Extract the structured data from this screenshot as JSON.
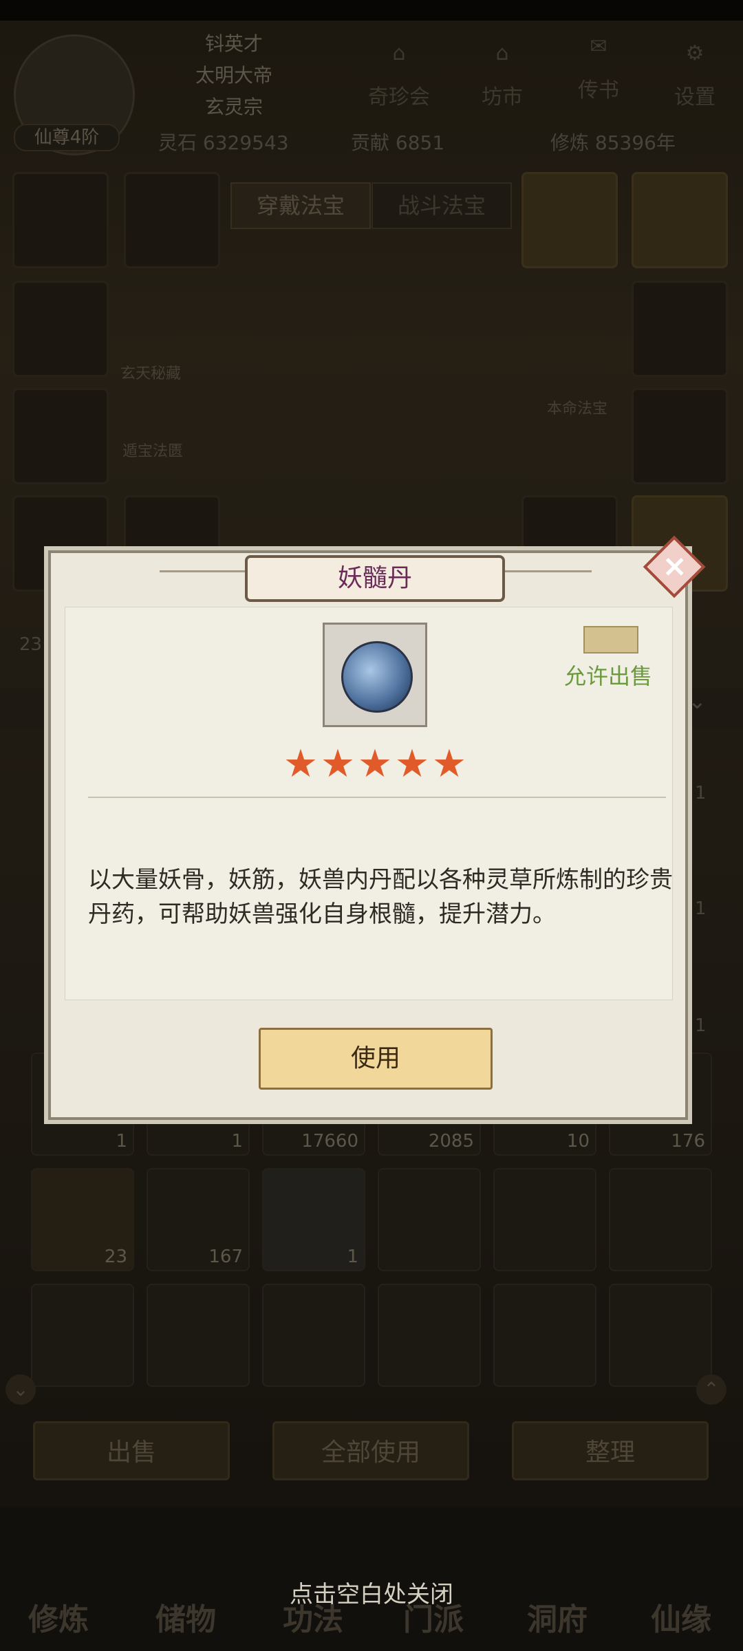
{
  "header": {
    "player_title": "仙尊4阶",
    "name_lines": [
      "钭英才",
      "太明大帝",
      "玄灵宗"
    ],
    "stats": [
      "灵石 6329543",
      "贡献 6851",
      "修炼 85396年"
    ],
    "top_menu": [
      "奇珍会",
      "坊市",
      "传书",
      "设置"
    ]
  },
  "equip": {
    "tabs": [
      "穿戴法宝",
      "战斗法宝"
    ],
    "side_labels": [
      "玄天秘藏",
      "遁宝法匮",
      "本命法宝"
    ]
  },
  "inventory": {
    "counts_row": [
      "1",
      "1",
      "17660",
      "2085",
      "10",
      "176"
    ],
    "counts_row2": [
      "23",
      "167",
      "1"
    ],
    "side_counts": [
      "23",
      "1",
      "1",
      "1"
    ],
    "buttons": [
      "出售",
      "全部使用",
      "整理"
    ]
  },
  "nav": [
    "修炼",
    "储物",
    "功法",
    "门派",
    "洞府",
    "仙缘"
  ],
  "modal": {
    "title": "妖髓丹",
    "sale_label": "允许出售",
    "stars": 5,
    "description": "以大量妖骨，妖筋，妖兽内丹配以各种灵草所炼制的珍贵丹药，可帮助妖兽强化自身根髓，提升潜力。",
    "use_button": "使用",
    "close_hint": "点击空白处关闭"
  },
  "colors": {
    "title_text": "#6a2b58",
    "sale_text": "#6b9a3e",
    "star": "#e05a2a",
    "use_button_bg": "#f1d79a"
  }
}
